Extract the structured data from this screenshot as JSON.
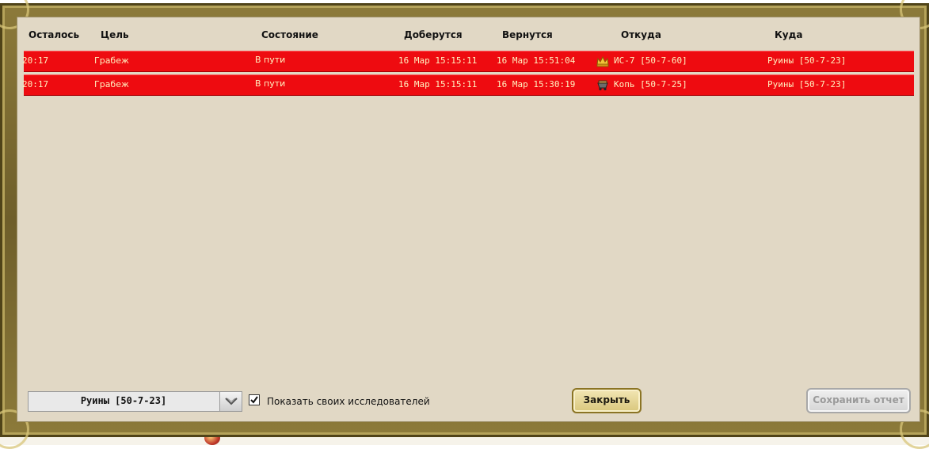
{
  "table": {
    "headers": {
      "remaining": "Осталось",
      "target": "Цель",
      "status": "Состояние",
      "arrive": "Доберутся",
      "return": "Вернутся",
      "from": "Откуда",
      "to": "Куда"
    },
    "rows": [
      {
        "remaining": "20:17",
        "target": "Грабеж",
        "status": "В пути",
        "arrive": "16 Мар 15:15:11",
        "return": "16 Мар 15:51:04",
        "from": "ИС-7 [50-7-60]",
        "from_icon": "crown-icon",
        "to": "Руины [50-7-23]"
      },
      {
        "remaining": "20:17",
        "target": "Грабеж",
        "status": "В пути",
        "arrive": "16 Мар 15:15:11",
        "return": "16 Мар 15:30:19",
        "from": "Копь [50-7-25]",
        "from_icon": "mine-cart-icon",
        "to": "Руины [50-7-23]"
      }
    ],
    "row_color": "#ee0b10"
  },
  "controls": {
    "location_select": "Руины [50-7-23]",
    "show_explorers_label": "Показать своих исследователей",
    "show_explorers_checked": true,
    "close_button": "Закрыть",
    "save_report_button": "Сохранить отчет"
  },
  "colors": {
    "frame": "#6e5e2a",
    "panel": "#e1d8c5",
    "row_text": "#fff2c0"
  }
}
